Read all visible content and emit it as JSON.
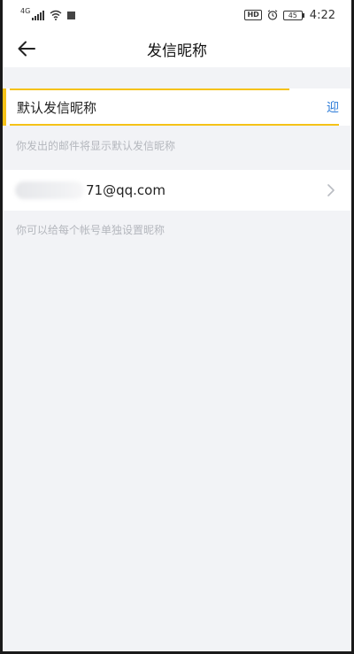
{
  "status_bar": {
    "signal_label": "4G",
    "battery_level": "45",
    "time": "4:22",
    "hd_label": "HD"
  },
  "header": {
    "title": "发信昵称"
  },
  "nickname": {
    "value": "默认发信昵称",
    "action_label": "迎"
  },
  "hints": {
    "default_nickname": "你发出的邮件将显示默认发信昵称",
    "per_account": "你可以给每个帐号单独设置昵称"
  },
  "account": {
    "email_visible": "71@qq.com"
  },
  "colors": {
    "accent": "#f5c217",
    "link": "#2f7dd9",
    "background": "#f2f3f6",
    "hint_text": "#b4b7bd"
  }
}
